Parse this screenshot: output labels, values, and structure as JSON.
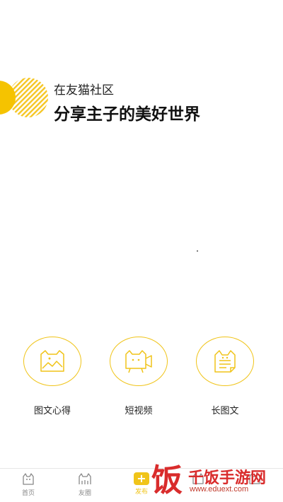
{
  "header": {
    "subtitle": "在友猫社区",
    "title": "分享主子的美好世界"
  },
  "options": [
    {
      "label": "图文心得",
      "icon": "cat-image-icon"
    },
    {
      "label": "短视频",
      "icon": "cat-video-icon"
    },
    {
      "label": "长图文",
      "icon": "cat-document-icon"
    }
  ],
  "tabbar": {
    "tabs": [
      {
        "label": "首页"
      },
      {
        "label": "友圈"
      },
      {
        "label": "发布",
        "active": true
      },
      {
        "label": ""
      },
      {
        "label": ""
      }
    ]
  },
  "watermark": {
    "logo_char": "饭",
    "name": "千饭手游网",
    "url": "www.eduext.com"
  },
  "colors": {
    "accent": "#f0c419",
    "watermark": "#d92c2c"
  }
}
